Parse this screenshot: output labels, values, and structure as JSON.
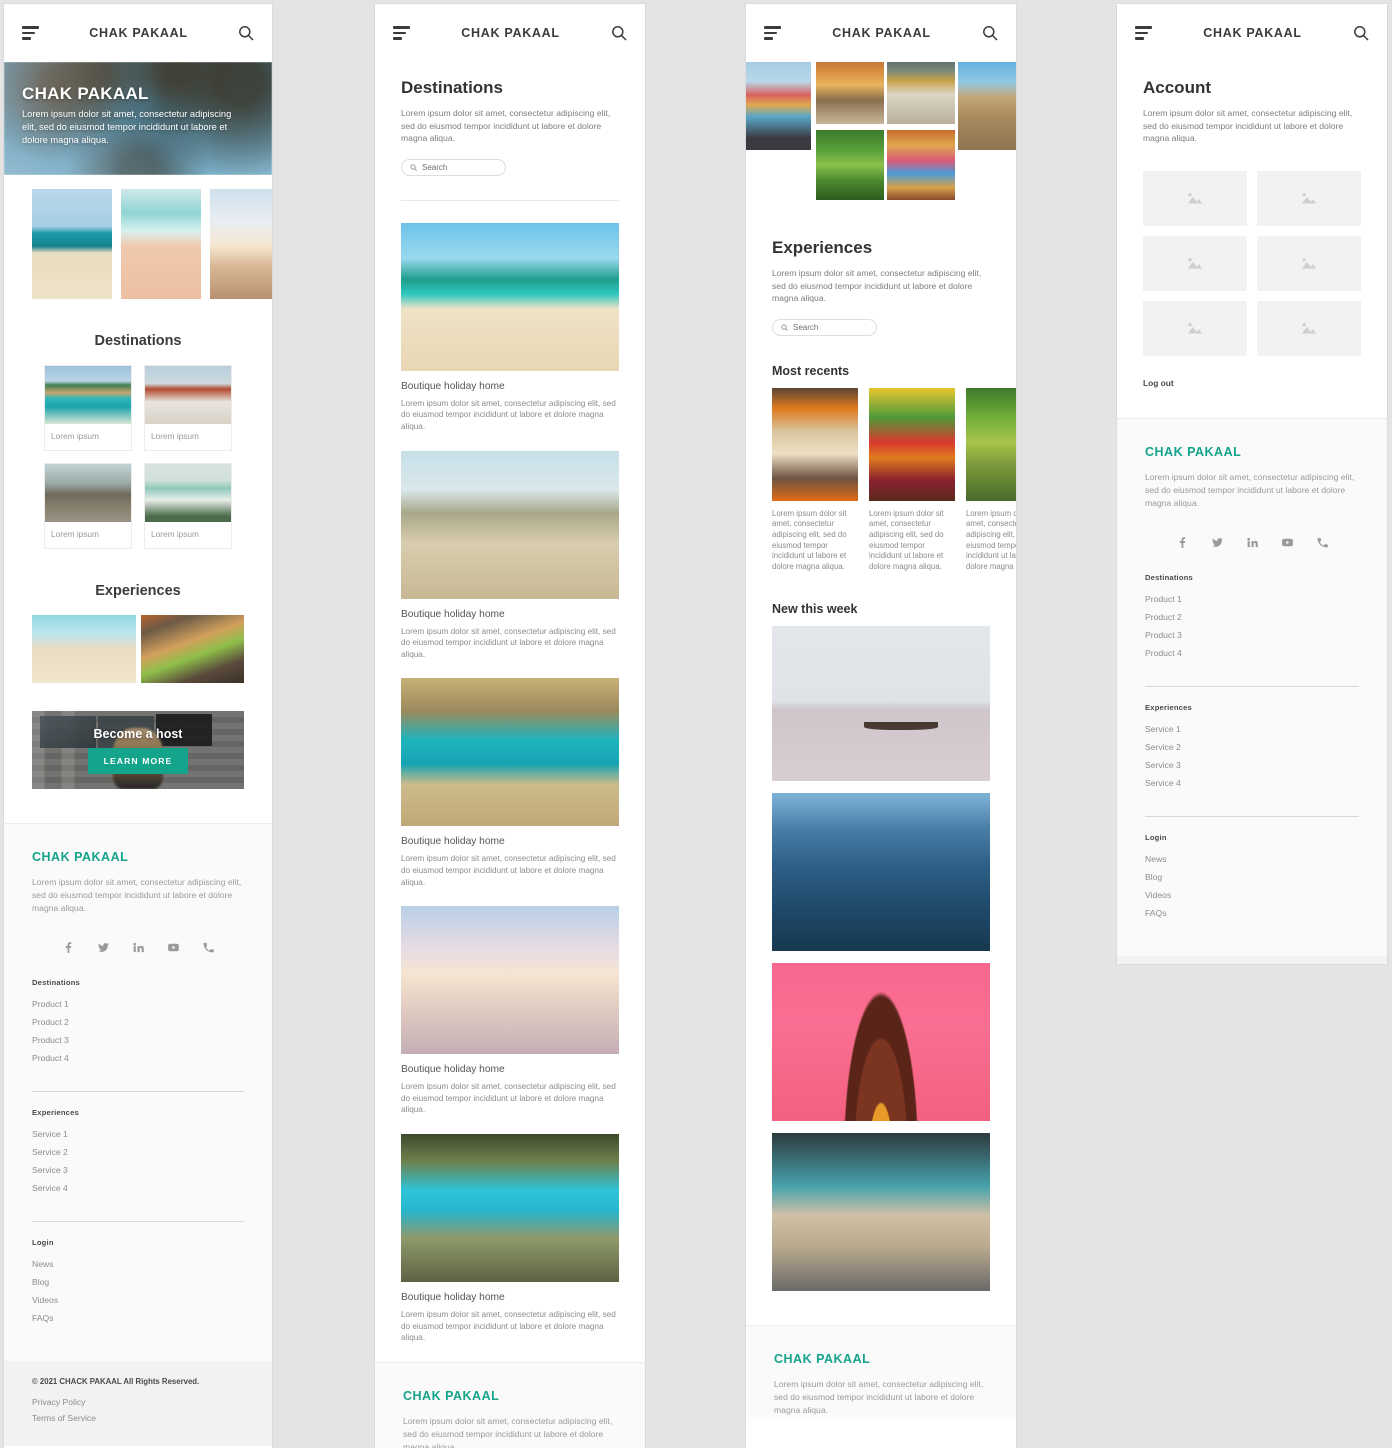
{
  "brand": {
    "name": "CHAK PAKAAL",
    "accent_color": "#14a38b"
  },
  "lorem": {
    "short": "Lorem ipsum dolor sit amet, consectetur adipiscing elit, sed do eiusmod tempor incididunt ut labore et dolore magna aliqua.",
    "card": "Lorem ipsum dolor sit amet, consectetur adipiscing elit, sed do eiusmod tempor incididunt ut labore et dolore magna aliqua.",
    "caption": "Lorem ipsum"
  },
  "panel1": {
    "topbar": {
      "title": "CHAK PAKAAL",
      "menu_icon": "hamburger-icon",
      "search_icon": "search-icon"
    },
    "hero": {
      "title": "CHAK PAKAAL",
      "text": "Lorem ipsum dolor sit amet, consectetur adipiscing elit, sed do eiusmod tempor incididunt ut labore et dolore magna aliqua."
    },
    "destinations_heading": "Destinations",
    "destination_cards": [
      {
        "caption": "Lorem ipsum"
      },
      {
        "caption": "Lorem ipsum"
      },
      {
        "caption": "Lorem ipsum"
      },
      {
        "caption": "Lorem ipsum"
      }
    ],
    "experiences_heading": "Experiences",
    "host": {
      "title": "Become a host",
      "button": "LEARN MORE"
    }
  },
  "panel2": {
    "topbar": {
      "title": "CHAK PAKAAL"
    },
    "heading": "Destinations",
    "description": "Lorem ipsum dolor sit amet, consectetur adipiscing elit, sed do eiusmod tempor incididunt ut labore et dolore magna aliqua.",
    "search_placeholder": "Search",
    "listings": [
      {
        "title": "Boutique holiday home",
        "text": "Lorem ipsum dolor sit amet, consectetur adipiscing elit, sed do eiusmod tempor incididunt ut labore et dolore magna aliqua."
      },
      {
        "title": "Boutique holiday home",
        "text": "Lorem ipsum dolor sit amet, consectetur adipiscing elit, sed do eiusmod tempor incididunt ut labore et dolore magna aliqua."
      },
      {
        "title": "Boutique holiday home",
        "text": "Lorem ipsum dolor sit amet, consectetur adipiscing elit, sed do eiusmod tempor incididunt ut labore et dolore magna aliqua."
      },
      {
        "title": "Boutique holiday home",
        "text": "Lorem ipsum dolor sit amet, consectetur adipiscing elit, sed do eiusmod tempor incididunt ut labore et dolore magna aliqua."
      },
      {
        "title": "Boutique holiday home",
        "text": "Lorem ipsum dolor sit amet, consectetur adipiscing elit, sed do eiusmod tempor incididunt ut labore et dolore magna aliqua."
      }
    ]
  },
  "panel3": {
    "topbar": {
      "title": "CHAK PAKAAL"
    },
    "heading": "Experiences",
    "description": "Lorem ipsum dolor sit amet, consectetur adipiscing elit, sed do eiusmod tempor incididunt ut labore et dolore magna aliqua.",
    "search_placeholder": "Search",
    "most_recents_heading": "Most recents",
    "most_recents": [
      {
        "text": "Lorem ipsum dolor sit amet, consectetur adipiscing elit, sed do eiusmod tempor incididunt ut labore et dolore magna aliqua."
      },
      {
        "text": "Lorem ipsum dolor sit amet, consectetur adipiscing elit, sed do eiusmod tempor incididunt ut labore et dolore magna aliqua."
      },
      {
        "text": "Lorem ipsum dolor sit amet, consectetur adipiscing elit, sed do eiusmod tempor incididunt ut labore et dolore magna aliqua."
      }
    ],
    "new_this_week_heading": "New this week"
  },
  "panel4": {
    "topbar": {
      "title": "CHAK PAKAAL"
    },
    "heading": "Account",
    "description": "Lorem ipsum dolor sit amet, consectetur adipiscing elit, sed do eiusmod tempor incididunt ut labore et dolore magna aliqua.",
    "gallery_count": 6,
    "logout": "Log out"
  },
  "footer": {
    "brand": "CHAK PAKAAL",
    "description": "Lorem ipsum dolor sit amet, consectetur adipiscing elit, sed do eiusmod tempor incididunt ut labore et dolore magna aliqua.",
    "socials": [
      "facebook-icon",
      "twitter-icon",
      "linkedin-icon",
      "youtube-icon",
      "phone-icon"
    ],
    "groups": [
      {
        "title": "Destinations",
        "links": [
          "Product 1",
          "Product 2",
          "Product 3",
          "Product 4"
        ]
      },
      {
        "title": "Experiences",
        "links": [
          "Service 1",
          "Service 2",
          "Service 3",
          "Service 4"
        ]
      },
      {
        "title": "Login",
        "links": [
          "News",
          "Blog",
          "Videos",
          "FAQs"
        ]
      }
    ],
    "copyright": "© 2021 CHACK PAKAAL All Rights Reserved.",
    "legal": [
      "Privacy Policy",
      "Terms of Service"
    ]
  }
}
